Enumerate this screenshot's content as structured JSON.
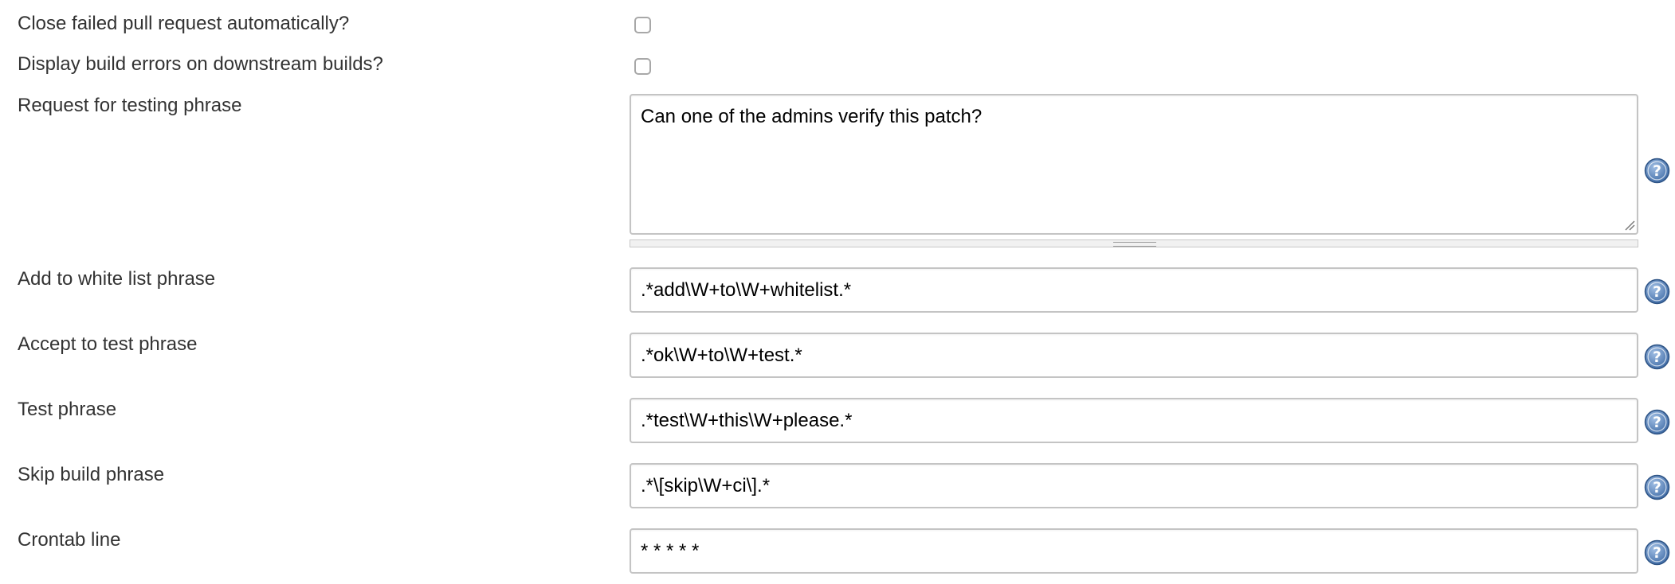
{
  "form": {
    "close_failed_pr": {
      "label": "Close failed pull request automatically?",
      "checked": false
    },
    "display_build_errors": {
      "label": "Display build errors on downstream builds?",
      "checked": false
    },
    "request_testing_phrase": {
      "label": "Request for testing phrase",
      "value": "Can one of the admins verify this patch?"
    },
    "whitelist_phrase": {
      "label": "Add to white list phrase",
      "value": ".*add\\W+to\\W+whitelist.*"
    },
    "accept_test_phrase": {
      "label": "Accept to test phrase",
      "value": ".*ok\\W+to\\W+test.*"
    },
    "test_phrase": {
      "label": "Test phrase",
      "value": ".*test\\W+this\\W+please.*"
    },
    "skip_build_phrase": {
      "label": "Skip build phrase",
      "value": ".*\\[skip\\W+ci\\].*"
    },
    "crontab_line": {
      "label": "Crontab line",
      "value": "* * * * *"
    }
  },
  "help_icon": {
    "name": "help-icon",
    "color": "#5a7fb4"
  }
}
